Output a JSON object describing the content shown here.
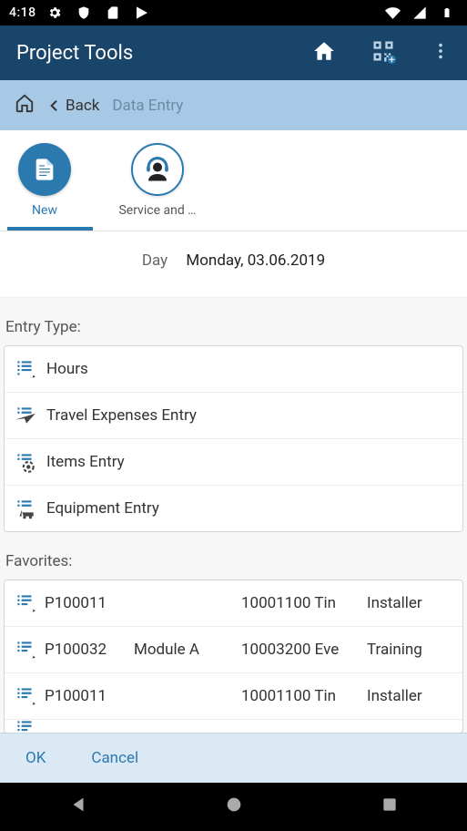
{
  "status": {
    "time": "4:18"
  },
  "title": "Project Tools",
  "breadcrumb": {
    "back": "Back",
    "current": "Data Entry"
  },
  "tabs": [
    {
      "label": "New",
      "active": true
    },
    {
      "label": "Service and …",
      "active": false
    }
  ],
  "day": {
    "label": "Day",
    "value": "Monday, 03.06.2019"
  },
  "entry_type_label": "Entry Type:",
  "entry_types": [
    {
      "label": "Hours"
    },
    {
      "label": "Travel Expenses Entry"
    },
    {
      "label": "Items Entry"
    },
    {
      "label": "Equipment Entry"
    }
  ],
  "favorites_label": "Favorites:",
  "favorites": [
    {
      "code": "P100011",
      "module": "",
      "cost": "10001100 Tin",
      "role": "Installer"
    },
    {
      "code": "P100032",
      "module": "Module A",
      "cost": "10003200 Eve",
      "role": "Training"
    },
    {
      "code": "P100011",
      "module": "",
      "cost": "10001100 Tin",
      "role": "Installer"
    }
  ],
  "footer": {
    "ok": "OK",
    "cancel": "Cancel"
  }
}
